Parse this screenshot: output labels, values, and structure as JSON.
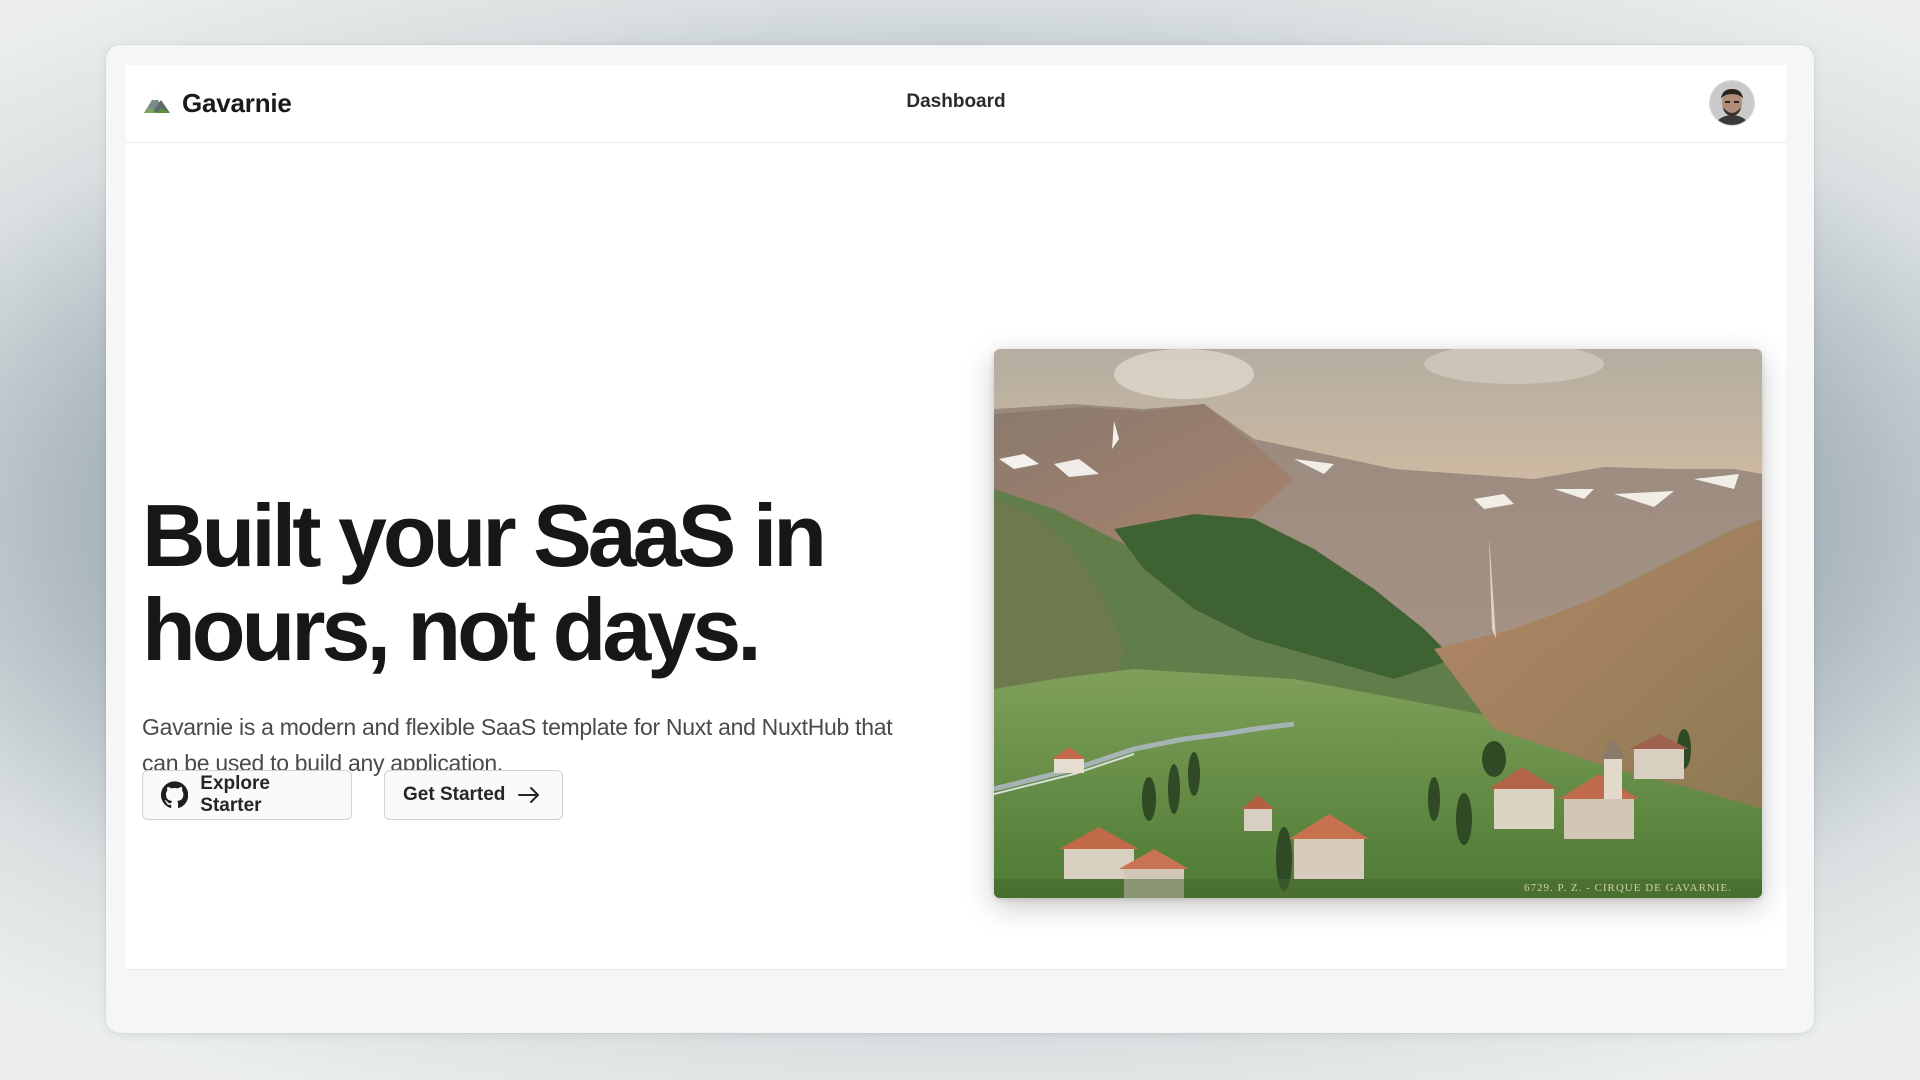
{
  "navbar": {
    "brand_name": "Gavarnie",
    "brand_icon": "mountain-icon",
    "nav_link": "Dashboard",
    "avatar_icon": "user-avatar"
  },
  "hero": {
    "title_line1": "Built your SaaS in",
    "title_line2": "hours, not days.",
    "description": "Gavarnie is a modern and flexible SaaS template for Nuxt and NuxtHub that can be used to build any application.",
    "buttons": [
      {
        "label": "Explore Starter",
        "icon": "github-icon"
      },
      {
        "label": "Get Started",
        "icon": "arrow-right-icon"
      }
    ],
    "image_caption": "6729. P. Z. - CIRQUE DE GAVARNIE."
  },
  "colors": {
    "background": "#ffffff",
    "text_primary": "#171717",
    "text_secondary": "#4a4a4a",
    "border": "#d2d2d2"
  }
}
